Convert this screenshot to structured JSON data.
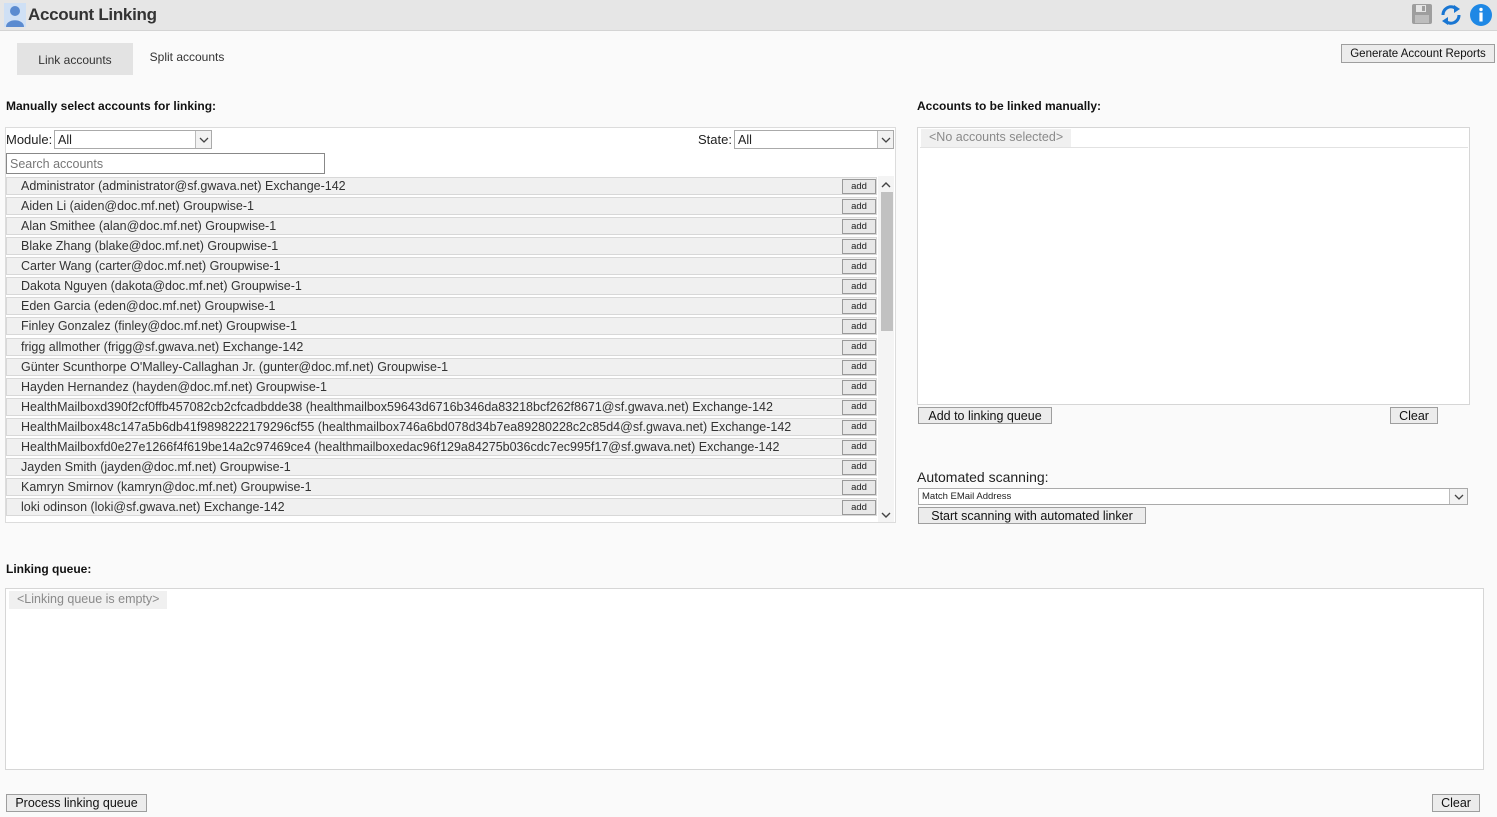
{
  "header": {
    "title": "Account Linking",
    "icons": {
      "app": "user-icon",
      "save": "floppy-icon",
      "refresh": "refresh-icon",
      "info": "info-icon"
    }
  },
  "tabs": [
    {
      "label": "Link accounts",
      "active": true
    },
    {
      "label": "Split accounts",
      "active": false
    }
  ],
  "toolbar": {
    "generate_reports": "Generate Account Reports"
  },
  "manual": {
    "title": "Manually select accounts for linking:",
    "module_label": "Module:",
    "module_value": "All",
    "state_label": "State:",
    "state_value": "All",
    "search_placeholder": "Search accounts",
    "add_label": "add",
    "accounts": [
      "Administrator (administrator@sf.gwava.net) Exchange-142",
      "Aiden Li (aiden@doc.mf.net) Groupwise-1",
      "Alan Smithee (alan@doc.mf.net) Groupwise-1",
      "Blake Zhang (blake@doc.mf.net) Groupwise-1",
      "Carter Wang (carter@doc.mf.net) Groupwise-1",
      "Dakota Nguyen (dakota@doc.mf.net) Groupwise-1",
      "Eden Garcia (eden@doc.mf.net) Groupwise-1",
      "Finley Gonzalez (finley@doc.mf.net) Groupwise-1",
      "frigg allmother (frigg@sf.gwava.net) Exchange-142",
      "Günter Scunthorpe O'Malley-Callaghan Jr. (gunter@doc.mf.net) Groupwise-1",
      "Hayden Hernandez (hayden@doc.mf.net) Groupwise-1",
      "HealthMailboxd390f2cf0ffb457082cb2cfcadbdde38 (healthmailbox59643d6716b346da83218bcf262f8671@sf.gwava.net) Exchange-142",
      "HealthMailbox48c147a5b6db41f9898222179296cf55 (healthmailbox746a6bd078d34b7ea89280228c2c85d4@sf.gwava.net) Exchange-142",
      "HealthMailboxfd0e27e1266f4f619be14a2c97469ce4 (healthmailboxedac96f129a84275b036cdc7ec995f17@sf.gwava.net) Exchange-142",
      "Jayden Smith (jayden@doc.mf.net) Groupwise-1",
      "Kamryn Smirnov (kamryn@doc.mf.net) Groupwise-1",
      "loki odinson (loki@sf.gwava.net) Exchange-142"
    ]
  },
  "linked": {
    "title": "Accounts to be linked manually:",
    "empty_text": "<No accounts selected>",
    "add_to_queue": "Add to linking queue",
    "clear": "Clear"
  },
  "automated": {
    "label": "Automated scanning:",
    "method_value": "Match EMail Address",
    "start_button": "Start scanning with automated linker"
  },
  "queue": {
    "title": "Linking queue:",
    "empty_text": "<Linking queue is empty>",
    "process_button": "Process linking queue",
    "clear": "Clear"
  },
  "colors": {
    "info_blue": "#1e88e5",
    "refresh_blue": "#1976d2",
    "user_blue": "#5b8bd0"
  }
}
